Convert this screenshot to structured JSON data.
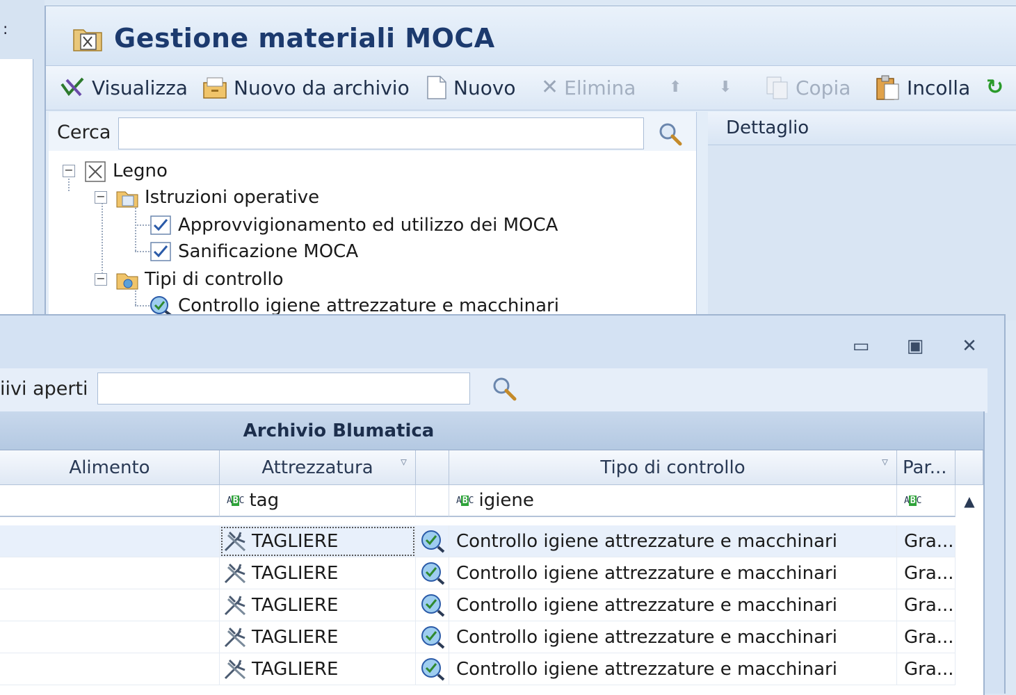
{
  "left_pane": {
    "fragment": ":"
  },
  "window": {
    "title": "Gestione materiali MOCA",
    "toolbar": [
      {
        "label": "Visualizza",
        "icon": "visualize-icon",
        "enabled": true
      },
      {
        "label": "Nuovo da archivio",
        "icon": "archive-new-icon",
        "enabled": true
      },
      {
        "label": "Nuovo",
        "icon": "new-document-icon",
        "enabled": true
      },
      {
        "label": "Elimina",
        "icon": "delete-icon",
        "enabled": false
      },
      {
        "label": "",
        "icon": "arrow-up-icon",
        "enabled": false
      },
      {
        "label": "",
        "icon": "arrow-down-icon",
        "enabled": false
      },
      {
        "label": "Copia",
        "icon": "copy-icon",
        "enabled": false
      },
      {
        "label": "Incolla",
        "icon": "paste-icon",
        "enabled": true
      }
    ],
    "search": {
      "label": "Cerca",
      "value": ""
    },
    "tree": {
      "root": "Legno",
      "groups": [
        {
          "label": "Istruzioni operative",
          "children": [
            "Approvvigionamento ed utilizzo dei MOCA",
            "Sanificazione MOCA"
          ]
        },
        {
          "label": "Tipi di controllo",
          "children": [
            "Controllo igiene attrezzature e macchinari"
          ]
        }
      ]
    },
    "detail": {
      "title": "Dettaglio"
    }
  },
  "dialog": {
    "search": {
      "label": "iivi aperti",
      "value": ""
    },
    "band_title": "Archivio Blumatica",
    "columns": [
      "Alimento",
      "Attrezzatura",
      "",
      "Tipo di controllo",
      "Par..."
    ],
    "filters": {
      "attrezzatura": "tag",
      "tipo": "igiene",
      "par": ""
    },
    "rows": [
      {
        "attrezzatura": "TAGLIERE",
        "tipo": "Controllo igiene attrezzature e macchinari",
        "par": "Gra..."
      },
      {
        "attrezzatura": "TAGLIERE",
        "tipo": "Controllo igiene attrezzature e macchinari",
        "par": "Gra..."
      },
      {
        "attrezzatura": "TAGLIERE",
        "tipo": "Controllo igiene attrezzature e macchinari",
        "par": "Gra..."
      },
      {
        "attrezzatura": "TAGLIERE",
        "tipo": "Controllo igiene attrezzature e macchinari",
        "par": "Gra..."
      },
      {
        "attrezzatura": "TAGLIERE",
        "tipo": "Controllo igiene attrezzature e macchinari",
        "par": "Gra..."
      }
    ]
  }
}
